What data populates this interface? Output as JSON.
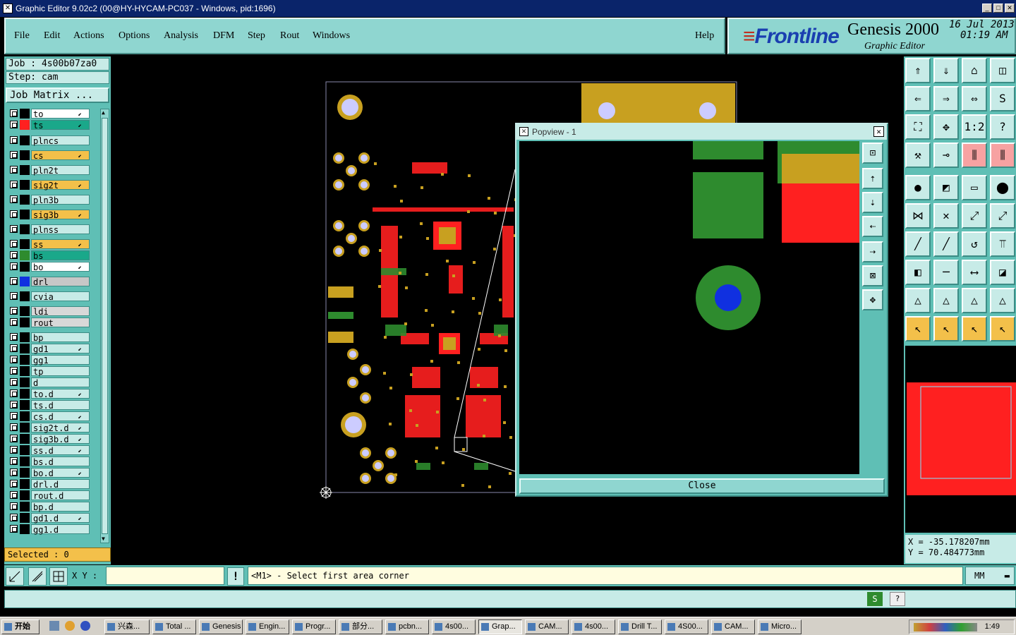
{
  "window": {
    "title": "Graphic Editor 9.02c2 (00@HY-HYCAM-PC037 - Windows, pid:1696)",
    "icon": "x-icon"
  },
  "menu": [
    "File",
    "Edit",
    "Actions",
    "Options",
    "Analysis",
    "DFM",
    "Step",
    "Rout",
    "Windows"
  ],
  "help": "Help",
  "brand": {
    "logo": "Frontline",
    "product": "Genesis 2000",
    "subtitle": "Graphic Editor",
    "date": "16 Jul 2013",
    "time": "01:19 AM"
  },
  "job": {
    "job": "Job : 4s00b07za0",
    "step": "Step: cam",
    "matrix": "Job Matrix ..."
  },
  "layers": [
    {
      "name": "to",
      "color": "#ffffff",
      "swatch": "#000000",
      "arrow": true
    },
    {
      "name": "ts",
      "color": "#1aa88a",
      "swatch": "#ff2020",
      "arrow": true
    },
    {
      "name": "plncs",
      "color": "#c7ebe7",
      "swatch": "",
      "arrow": false
    },
    {
      "name": "cs",
      "color": "#f3c04a",
      "swatch": "",
      "arrow": true
    },
    {
      "name": "pln2t",
      "color": "#c7ebe7",
      "swatch": "",
      "arrow": false
    },
    {
      "name": "sig2t",
      "color": "#f3c04a",
      "swatch": "",
      "arrow": true
    },
    {
      "name": "pln3b",
      "color": "#c7ebe7",
      "swatch": "",
      "arrow": false
    },
    {
      "name": "sig3b",
      "color": "#f3c04a",
      "swatch": "",
      "arrow": true
    },
    {
      "name": "plnss",
      "color": "#c7ebe7",
      "swatch": "",
      "arrow": false
    },
    {
      "name": "ss",
      "color": "#f3c04a",
      "swatch": "",
      "arrow": true
    },
    {
      "name": "bs",
      "color": "#1aa88a",
      "swatch": "#2e8b2e",
      "arrow": false
    },
    {
      "name": "bo",
      "color": "#ffffff",
      "swatch": "",
      "arrow": true
    },
    {
      "name": "drl",
      "color": "#c7c7c7",
      "swatch": "#1030e0",
      "arrow": false
    },
    {
      "name": "cvia",
      "color": "#c7ebe7",
      "swatch": "",
      "arrow": false
    },
    {
      "name": "ldi",
      "color": "#d8d8d8",
      "swatch": "",
      "arrow": false
    },
    {
      "name": "rout",
      "color": "#d8d8d8",
      "swatch": "",
      "arrow": false
    },
    {
      "name": "bp",
      "color": "#c7ebe7",
      "swatch": "",
      "arrow": false
    },
    {
      "name": "gd1",
      "color": "#c7ebe7",
      "swatch": "",
      "arrow": true
    },
    {
      "name": "gg1",
      "color": "#c7ebe7",
      "swatch": "",
      "arrow": false
    },
    {
      "name": "tp",
      "color": "#c7ebe7",
      "swatch": "",
      "arrow": false
    },
    {
      "name": "d",
      "color": "#c7ebe7",
      "swatch": "",
      "arrow": false
    },
    {
      "name": "to.d",
      "color": "#c7ebe7",
      "swatch": "",
      "arrow": true
    },
    {
      "name": "ts.d",
      "color": "#c7ebe7",
      "swatch": "",
      "arrow": false
    },
    {
      "name": "cs.d",
      "color": "#c7ebe7",
      "swatch": "",
      "arrow": true
    },
    {
      "name": "sig2t.d",
      "color": "#c7ebe7",
      "swatch": "",
      "arrow": true
    },
    {
      "name": "sig3b.d",
      "color": "#c7ebe7",
      "swatch": "",
      "arrow": true
    },
    {
      "name": "ss.d",
      "color": "#c7ebe7",
      "swatch": "",
      "arrow": true
    },
    {
      "name": "bs.d",
      "color": "#c7ebe7",
      "swatch": "",
      "arrow": false
    },
    {
      "name": "bo.d",
      "color": "#c7ebe7",
      "swatch": "",
      "arrow": true
    },
    {
      "name": "drl.d",
      "color": "#c7ebe7",
      "swatch": "",
      "arrow": false
    },
    {
      "name": "rout.d",
      "color": "#c7ebe7",
      "swatch": "",
      "arrow": false
    },
    {
      "name": "bp.d",
      "color": "#c7ebe7",
      "swatch": "",
      "arrow": false
    },
    {
      "name": "gd1.d",
      "color": "#c7ebe7",
      "swatch": "",
      "arrow": true
    },
    {
      "name": "gg1.d",
      "color": "#c7ebe7",
      "swatch": "",
      "arrow": false
    }
  ],
  "selected": "Selected : 0",
  "xy_label": "X Y :",
  "prompt": "<M1> - Select first area corner",
  "unit": "MM",
  "popview": {
    "title": "Popview - 1",
    "close": "Close"
  },
  "coords": {
    "x": "X = -35.178207mm",
    "y": "Y = 70.484773mm"
  },
  "taskbar": {
    "start": "开始",
    "items": [
      "兴森...",
      "Total ...",
      "Genesis",
      "Engin...",
      "Progr...",
      "部分...",
      "pcbn...",
      "4s00...",
      "Grap...",
      "CAM...",
      "4s00...",
      "Drill T...",
      "4S00...",
      "CAM...",
      "Micro..."
    ],
    "active": 8,
    "clock": "1:49"
  },
  "colors": {
    "teal": "#5fbfb5",
    "light_teal": "#c7ebe7",
    "pad_green": "#2e8b2e",
    "pad_red": "#ff2020",
    "gold": "#c8a020",
    "drill_blue": "#1030e0"
  }
}
